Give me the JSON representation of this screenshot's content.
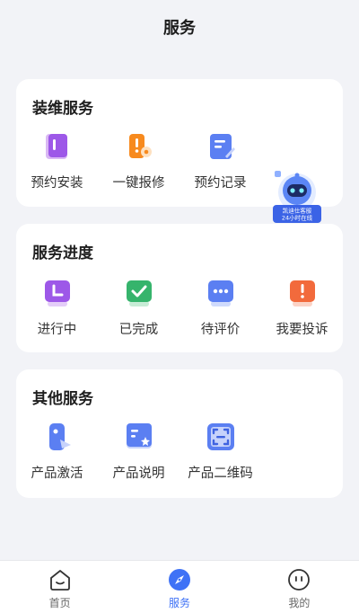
{
  "header": {
    "title": "服务"
  },
  "sections": [
    {
      "title": "装维服务",
      "items": [
        {
          "label": "预约安装",
          "icon": "booking-install-icon"
        },
        {
          "label": "一键报修",
          "icon": "repair-report-icon"
        },
        {
          "label": "预约记录",
          "icon": "booking-record-icon"
        }
      ]
    },
    {
      "title": "服务进度",
      "items": [
        {
          "label": "进行中",
          "icon": "in-progress-icon"
        },
        {
          "label": "已完成",
          "icon": "completed-icon"
        },
        {
          "label": "待评价",
          "icon": "pending-review-icon"
        },
        {
          "label": "我要投诉",
          "icon": "complaint-icon"
        }
      ]
    },
    {
      "title": "其他服务",
      "items": [
        {
          "label": "产品激活",
          "icon": "product-activate-icon"
        },
        {
          "label": "产品说明",
          "icon": "product-manual-icon"
        },
        {
          "label": "产品二维码",
          "icon": "qr-code-icon"
        }
      ]
    }
  ],
  "assistant": {
    "icon": "robot-assistant-icon",
    "line1": "凯迪仕客服",
    "line2": "24小时在线"
  },
  "tabbar": [
    {
      "label": "首页",
      "icon": "home-icon",
      "active": false
    },
    {
      "label": "服务",
      "icon": "compass-icon",
      "active": true
    },
    {
      "label": "我的",
      "icon": "profile-icon",
      "active": false
    }
  ],
  "colors": {
    "accent": "#3f72f6",
    "background": "#f2f3f7",
    "card": "#ffffff"
  }
}
